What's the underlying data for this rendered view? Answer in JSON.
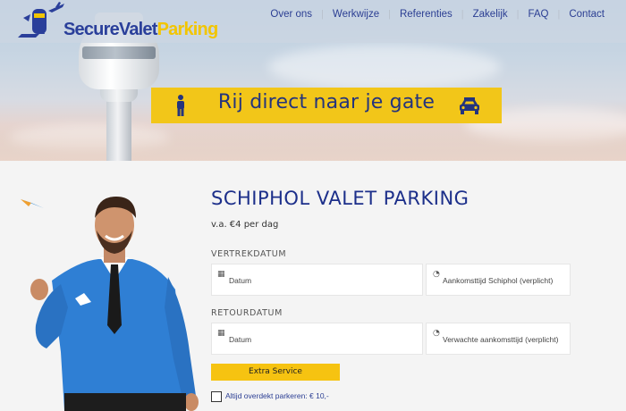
{
  "header": {
    "logo": {
      "part1": "SecureValet",
      "part2": "Parking"
    },
    "nav": [
      "Over ons",
      "Werkwijze",
      "Referenties",
      "Zakelijk",
      "FAQ",
      "Contact"
    ]
  },
  "hero": {
    "banner_text": "Rij direct naar je gate",
    "icons": [
      "person-icon",
      "car-icon"
    ]
  },
  "main": {
    "title": "SCHIPHOL VALET PARKING",
    "price": "v.a. €4 per dag",
    "departure": {
      "label": "VERTREKDATUM",
      "date_placeholder": "Datum",
      "time_placeholder": "Aankomsttijd Schiphol (verplicht)"
    },
    "return": {
      "label": "RETOURDATUM",
      "date_placeholder": "Datum",
      "time_placeholder": "Verwachte aankomsttijd (verplicht)"
    },
    "extra_button": "Extra Service",
    "checkbox_label": "Altijd overdekt parkeren: € 10,-"
  },
  "colors": {
    "brand_blue": "#1c2f8a",
    "brand_yellow": "#f2c619",
    "nav_text": "#2b3e93"
  }
}
